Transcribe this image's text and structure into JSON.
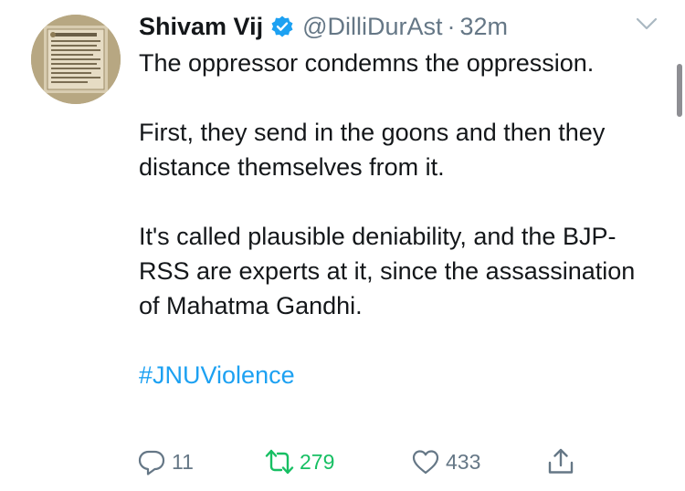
{
  "tweet": {
    "author_name": "Shivam Vij",
    "handle": "@DilliDurAst",
    "separator": "·",
    "time": "32m",
    "paragraphs": [
      "The oppressor condemns the oppression.",
      "First, they send in the goons and then they distance themselves from it.",
      "It's called plausible deniability, and the BJP-RSS are experts at it, since the assassination of Mahatma Gandhi."
    ],
    "hashtag": "#JNUViolence"
  },
  "actions": {
    "replies": "11",
    "retweets": "279",
    "likes": "433"
  },
  "icons": {
    "verified": "verified-badge-icon",
    "menu": "chevron-down-icon",
    "reply": "reply-icon",
    "retweet": "retweet-icon",
    "like": "heart-icon",
    "share": "share-icon"
  },
  "colors": {
    "accent": "#1da1f2",
    "retweet_active": "#17bf63",
    "secondary_text": "#657786",
    "primary_text": "#14171a"
  }
}
